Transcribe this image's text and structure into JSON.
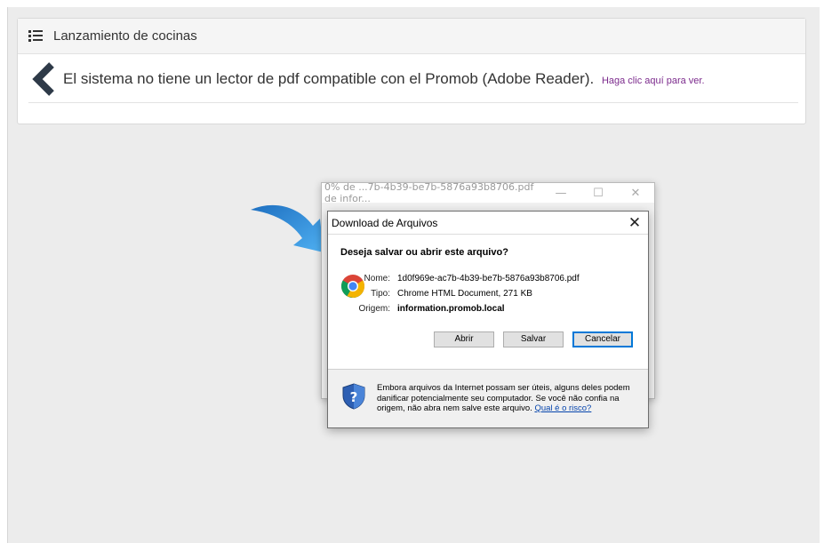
{
  "panel": {
    "title": "Lanzamiento de cocinas",
    "message": "El sistema no tiene un lector de pdf compatible con el Promob (Adobe Reader).",
    "link": "Haga clic aquí para ver."
  },
  "background_window": {
    "title": "0% de ...7b-4b39-be7b-5876a93b8706.pdf de infor...",
    "minimize": "—",
    "maximize": "☐",
    "close": "✕"
  },
  "dialog": {
    "title": "Download de Arquivos",
    "close": "✕",
    "question": "Deseja salvar ou abrir este arquivo?",
    "name_label": "Nome:",
    "name_value": "1d0f969e-ac7b-4b39-be7b-5876a93b8706.pdf",
    "type_label": "Tipo:",
    "type_value": "Chrome HTML Document, 271 KB",
    "origin_label": "Origem:",
    "origin_value": "information.promob.local",
    "buttons": {
      "open": "Abrir",
      "save": "Salvar",
      "cancel": "Cancelar"
    },
    "warning_text": "Embora arquivos da Internet possam ser úteis, alguns deles podem danificar potencialmente seu computador. Se você não confia na origem, não abra nem salve este arquivo.",
    "risk_link": "Qual é o risco?"
  },
  "colors": {
    "arrow": "#2a8fe0",
    "link": "#7b2a8c",
    "accent": "#0078d7"
  }
}
